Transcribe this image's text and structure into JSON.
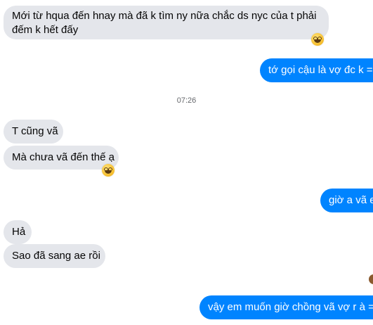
{
  "messages": [
    {
      "id": "m1",
      "side": "in",
      "text": "Mới từ hqua đến hnay mà đã k tìm ny nữa chắc ds nyc của t phải đếm k hết đấy",
      "reaction": "laughing-emoji"
    },
    {
      "id": "m2",
      "side": "out",
      "text": "tớ gọi cậu là vợ đc k ="
    },
    {
      "id": "m3",
      "side": "in",
      "text": "T cũng vã"
    },
    {
      "id": "m4",
      "side": "in",
      "text": "Mà chưa vã đến thế ạ",
      "reaction": "laughing-emoji"
    },
    {
      "id": "m5",
      "side": "out",
      "text": "giờ a vã e"
    },
    {
      "id": "m6",
      "side": "in",
      "text": "Hả"
    },
    {
      "id": "m7",
      "side": "in",
      "text": "Sao đã sang ae rồi"
    },
    {
      "id": "m8",
      "side": "out",
      "text": "vậy em muốn giờ chồng vã vợ r à ="
    }
  ],
  "timestamp": "07:26",
  "colors": {
    "incoming_bubble": "#e4e6eb",
    "outgoing_bubble": "#0084ff",
    "timestamp_text": "#65676b"
  }
}
